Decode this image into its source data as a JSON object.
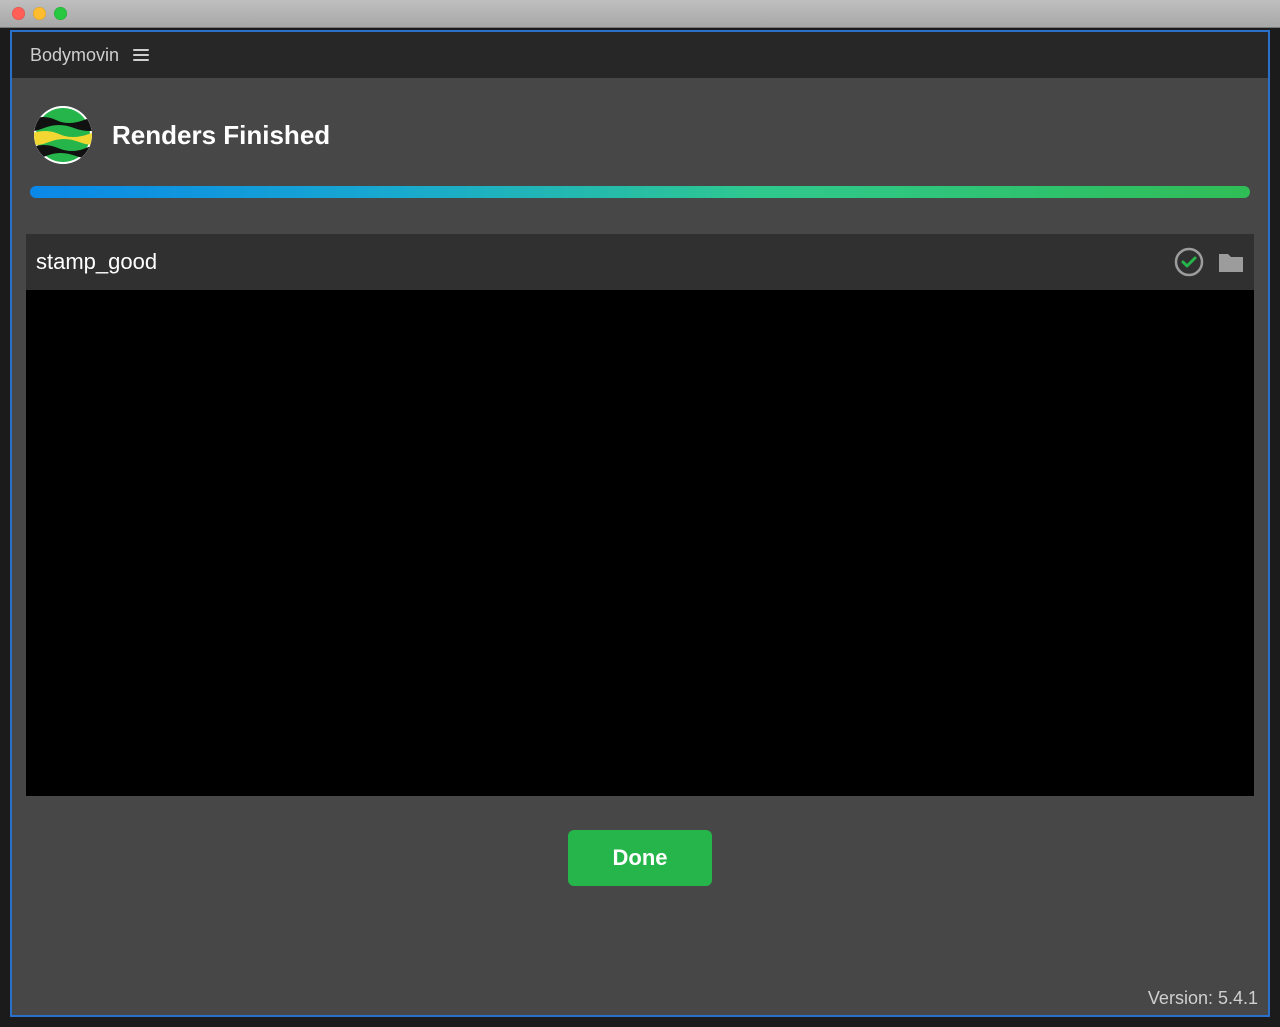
{
  "panel_title": "Bodymovin",
  "status_heading": "Renders Finished",
  "item": {
    "name": "stamp_good"
  },
  "buttons": {
    "done_label": "Done"
  },
  "version_label": "Version: 5.4.1",
  "colors": {
    "accent_green": "#26b54a",
    "panel_border": "#2a6fc9"
  }
}
